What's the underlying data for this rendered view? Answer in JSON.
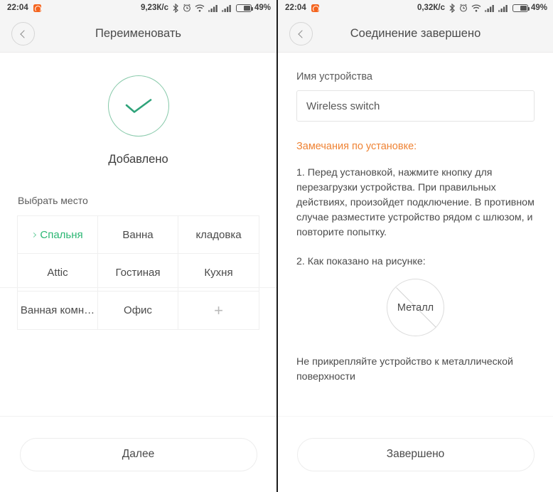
{
  "left": {
    "status": {
      "time": "22:04",
      "app_icon": "notification-app-icon",
      "speed": "9,23К/с",
      "bluetooth": "bluetooth-icon",
      "alarm": "alarm-icon",
      "wifi": "wifi-icon",
      "signal1": "signal-icon",
      "signal2": "signal-icon",
      "battery": "49%"
    },
    "title": "Переименовать",
    "back": "back-button",
    "success": {
      "icon": "check-circle-icon",
      "label": "Добавлено"
    },
    "pick_place_label": "Выбрать место",
    "rooms": [
      {
        "label": "Спальня",
        "selected": true
      },
      {
        "label": "Ванна",
        "selected": false
      },
      {
        "label": "кладовка",
        "selected": false
      },
      {
        "label": "Attic",
        "selected": false
      },
      {
        "label": "Гостиная",
        "selected": false
      },
      {
        "label": "Кухня",
        "selected": false
      },
      {
        "label": "Ванная комн…",
        "selected": false
      },
      {
        "label": "Офис",
        "selected": false
      },
      {
        "label": "+",
        "selected": false
      }
    ],
    "cta": "Далее"
  },
  "right": {
    "status": {
      "time": "22:04",
      "app_icon": "notification-app-icon",
      "speed": "0,32К/с",
      "battery": "49%"
    },
    "title": "Соединение завершено",
    "back": "back-button",
    "device_name_label": "Имя устройства",
    "device_name_value": "Wireless switch",
    "device_name_placeholder": "Имя устройства",
    "notes_heading": "Замечания по установке:",
    "note_1": "1. Перед установкой, нажмите кнопку для перезагрузки устройства. При правильных действиях, произойдет подключение. В противном случае разместите устройство рядом с шлюзом, и повторите попытку.",
    "note_2": "2. Как показано на рисунке:",
    "metal_label": "Металл",
    "note_3": "Не прикрепляйте устройство к металлической поверхности",
    "cta": "Завершено"
  },
  "colors": {
    "accent_green": "#2bb673",
    "check_ring": "#86c9a9",
    "notes_orange": "#ef8334",
    "status_bg": "#f5f5f5",
    "app_icon_orange": "#f4641e"
  }
}
